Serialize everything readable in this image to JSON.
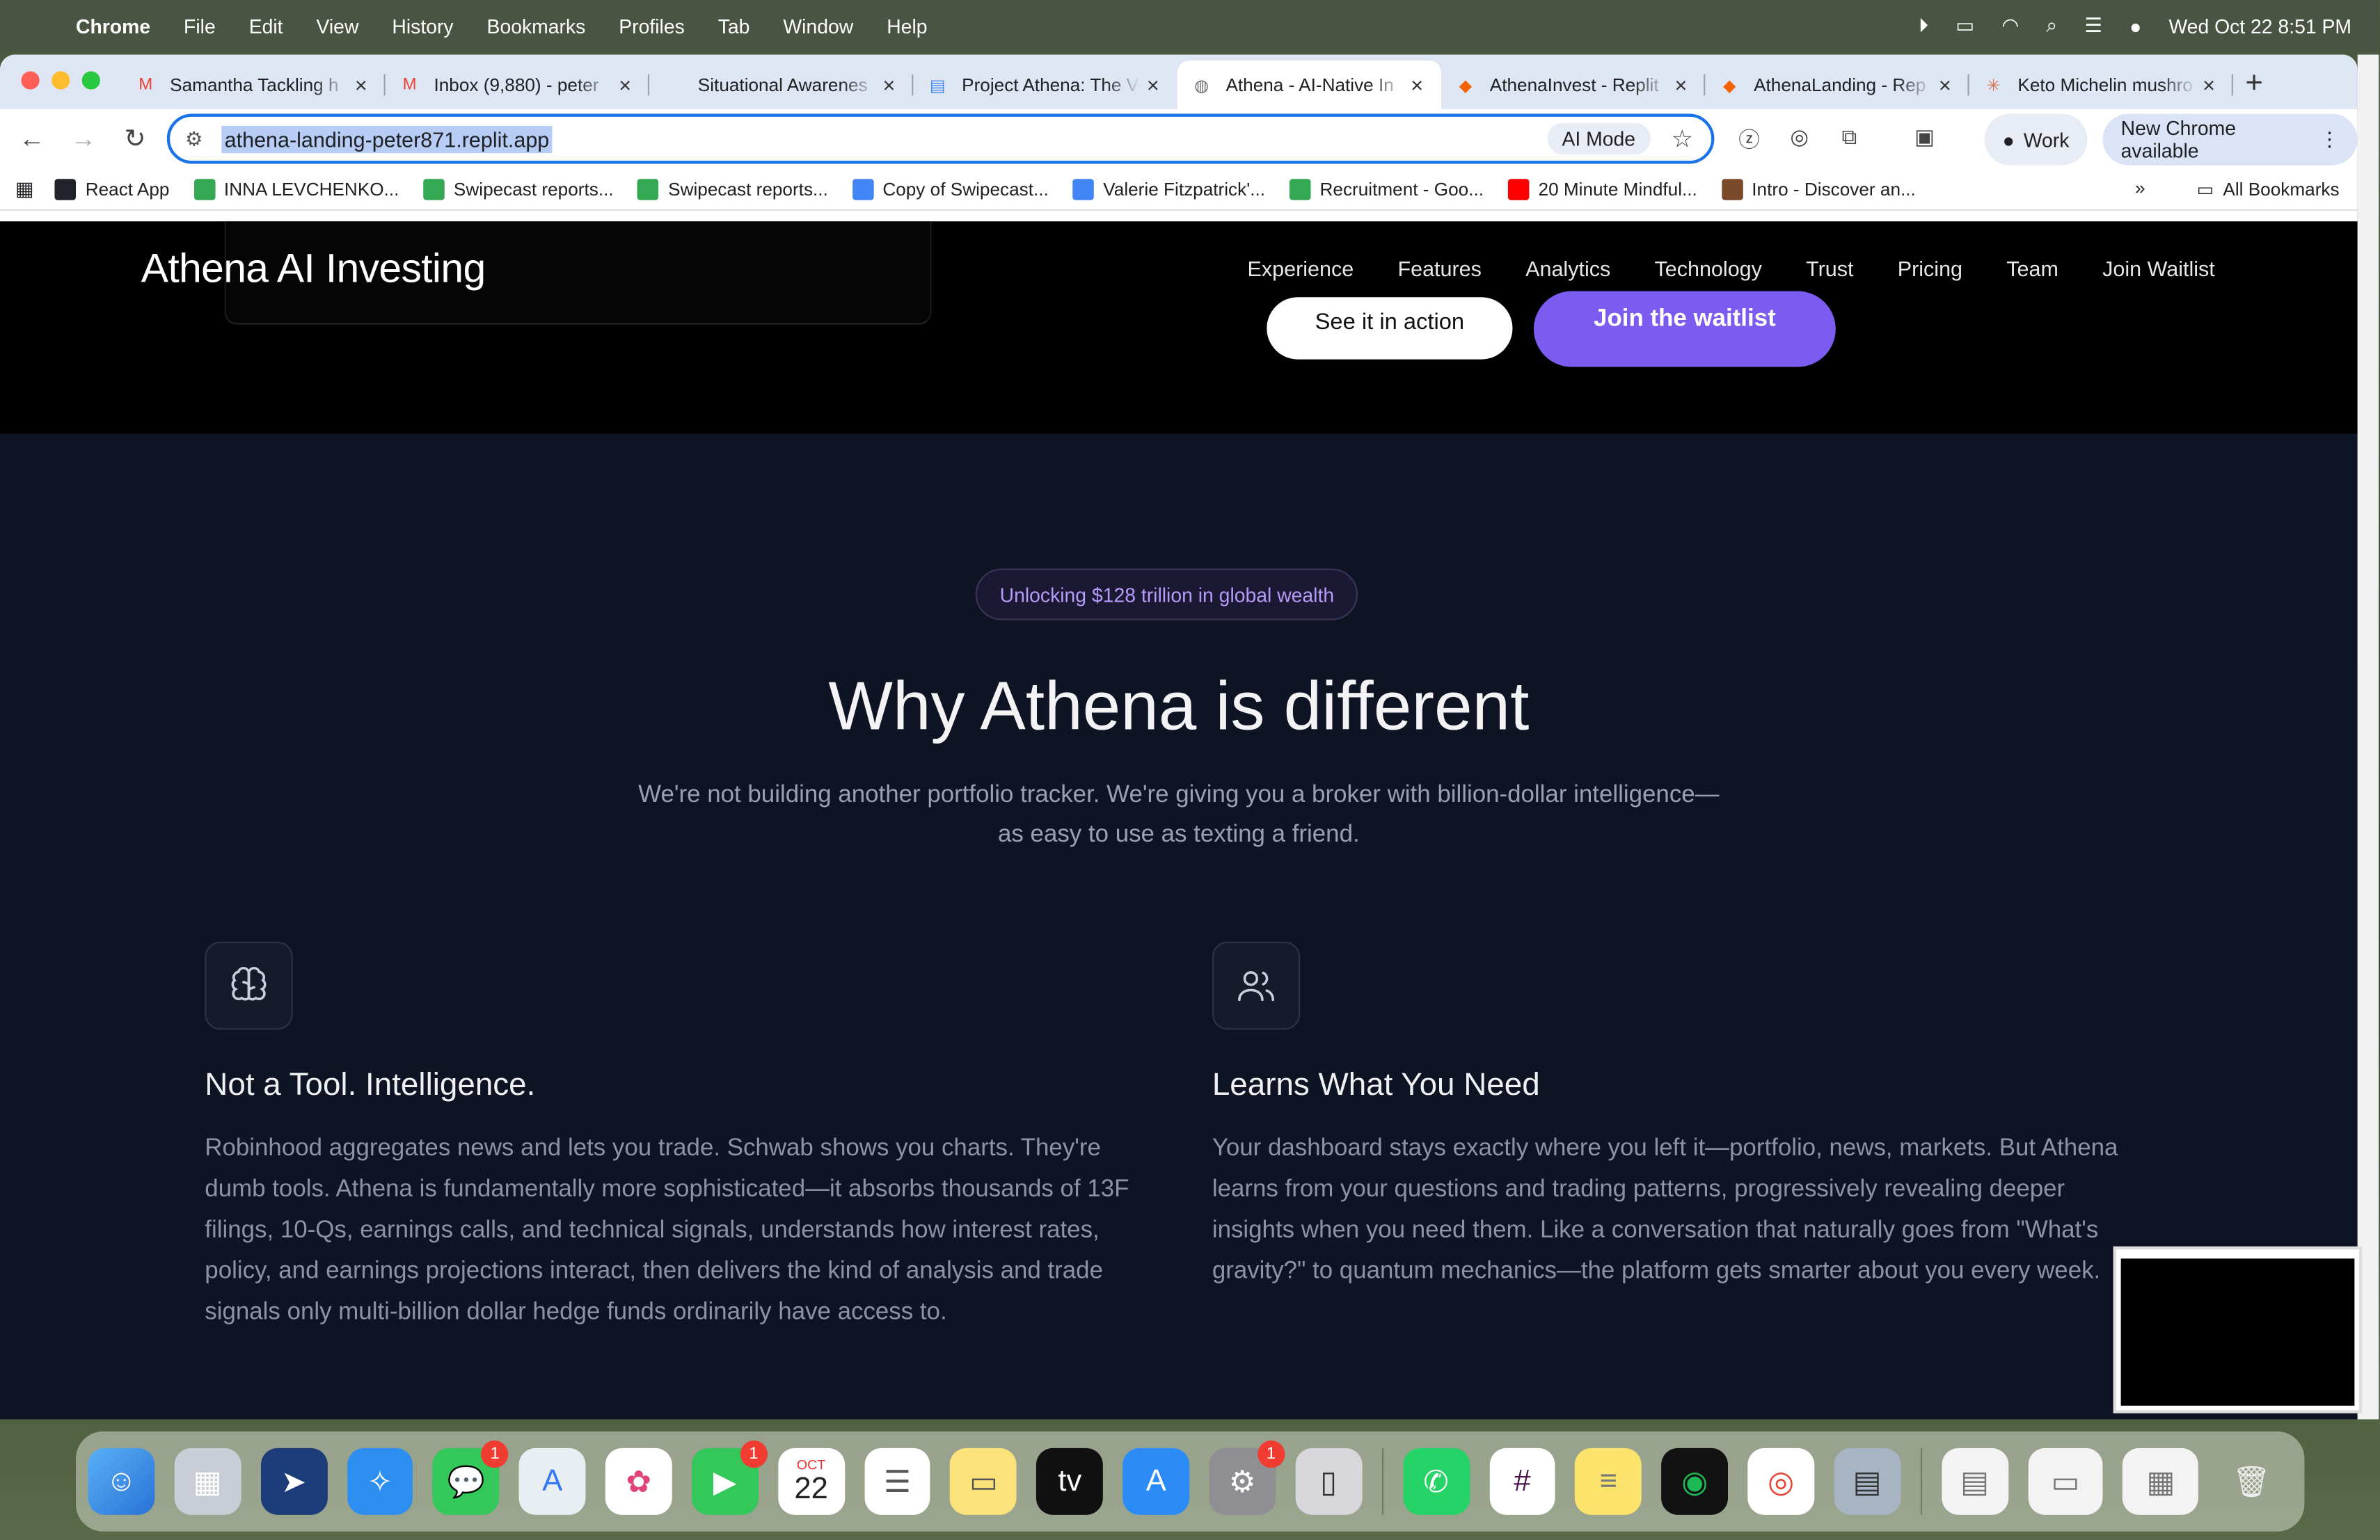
{
  "menubar": {
    "app": "Chrome",
    "items": [
      "File",
      "Edit",
      "View",
      "History",
      "Bookmarks",
      "Profiles",
      "Tab",
      "Window",
      "Help"
    ],
    "datetime": "Wed Oct 22  8:51 PM"
  },
  "tabs": [
    {
      "title": "Samantha Tackling h",
      "icon": "gmail-icon",
      "color": "#ea4335"
    },
    {
      "title": "Inbox (9,880) - peter",
      "icon": "gmail-icon",
      "color": "#ea4335"
    },
    {
      "title": "Situational Awarenes",
      "icon": "blank-icon",
      "color": "#dfe6f3"
    },
    {
      "title": "Project Athena: The V",
      "icon": "docs-icon",
      "color": "#4285f4"
    },
    {
      "title": "Athena - AI-Native In",
      "icon": "globe-icon",
      "color": "#5f6368"
    },
    {
      "title": "AthenaInvest - Replit",
      "icon": "replit-icon",
      "color": "#f26207"
    },
    {
      "title": "AthenaLanding - Rep",
      "icon": "replit-icon",
      "color": "#f26207"
    },
    {
      "title": "Keto Michelin mushro",
      "icon": "claude-icon",
      "color": "#d97757"
    }
  ],
  "toolbar": {
    "url": "athena-landing-peter871.replit.app",
    "ai_mode": "AI Mode",
    "work": "Work",
    "update": "New Chrome available"
  },
  "bookmarks": [
    {
      "label": "React App",
      "color": "#20232a"
    },
    {
      "label": "INNA LEVCHENKO...",
      "color": "#34a853"
    },
    {
      "label": "Swipecast reports...",
      "color": "#34a853"
    },
    {
      "label": "Swipecast reports...",
      "color": "#34a853"
    },
    {
      "label": "Copy of Swipecast...",
      "color": "#4285f4"
    },
    {
      "label": "Valerie Fitzpatrick'...",
      "color": "#4285f4"
    },
    {
      "label": "Recruitment - Goo...",
      "color": "#34a853"
    },
    {
      "label": "20 Minute Mindful...",
      "color": "#ff0000"
    },
    {
      "label": "Intro - Discover an...",
      "color": "#7a4a2a"
    }
  ],
  "all_bookmarks": "All Bookmarks",
  "site": {
    "brand": "Athena AI Investing",
    "nav": [
      "Experience",
      "Features",
      "Analytics",
      "Technology",
      "Trust",
      "Pricing",
      "Team",
      "Join Waitlist"
    ],
    "see_button": "See it in action",
    "join_button": "Join the waitlist",
    "pill": "Unlocking $128 trillion in global wealth",
    "heading": "Why Athena is different",
    "subheading": "We're not building another portfolio tracker. We're giving you a broker with billion-dollar intelligence—as easy to use as texting a friend.",
    "cards": [
      {
        "title": "Not a Tool. Intelligence.",
        "icon": "brain-icon",
        "body": "Robinhood aggregates news and lets you trade. Schwab shows you charts. They're dumb tools. Athena is fundamentally more sophisticated—it absorbs thousands of 13F filings, 10-Qs, earnings calls, and technical signals, understands how interest rates, policy, and earnings projections interact, then delivers the kind of analysis and trade signals only multi-billion dollar hedge funds ordinarily have access to."
      },
      {
        "title": "Learns What You Need",
        "icon": "users-icon",
        "body": "Your dashboard stays exactly where you left it—portfolio, news, markets. But Athena learns from your questions and trading patterns, progressively revealing deeper insights when you need them. Like a conversation that naturally goes from \"What's gravity?\" to quantum mechanics—the platform gets smarter about you every week."
      }
    ]
  },
  "dock": {
    "calendar_month": "OCT",
    "calendar_day": "22",
    "badge_messages": "1",
    "badge_facetime": "1",
    "badge_settings": "1"
  }
}
